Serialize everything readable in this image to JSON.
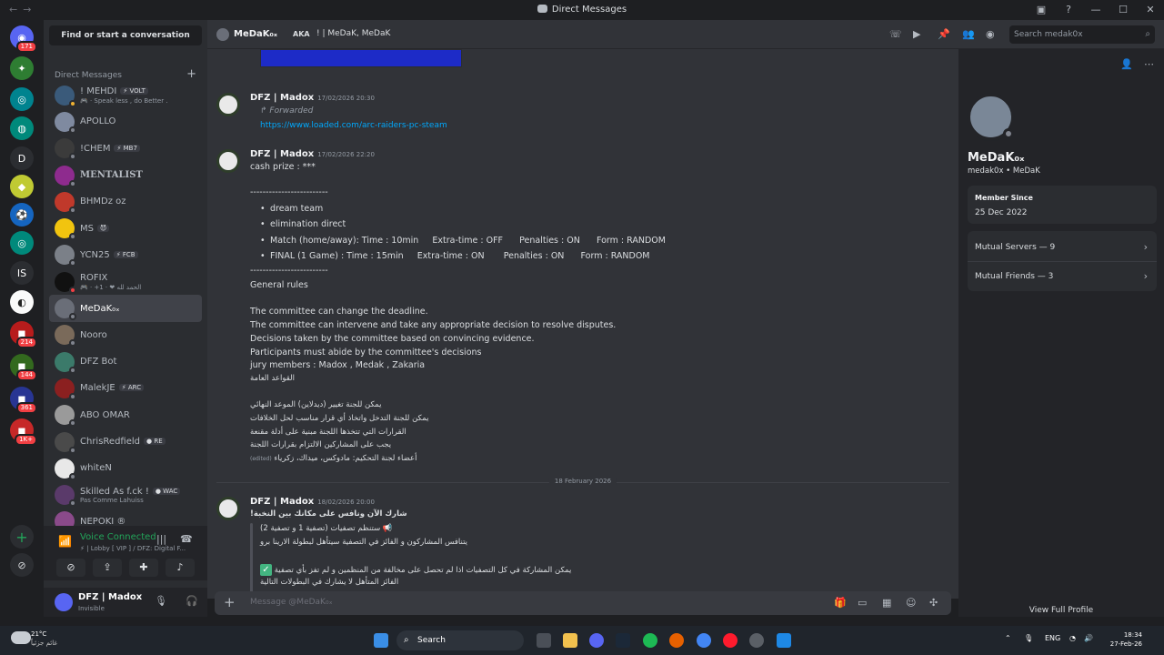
{
  "window": {
    "title": "Direct Messages",
    "controls": [
      "—",
      "☐",
      "✕"
    ]
  },
  "rail": {
    "servers": [
      {
        "name": "discord-home",
        "badge": "171",
        "color": "#5865f2",
        "glyph": "◉"
      },
      {
        "name": "server-1",
        "badge": "",
        "color": "#2e7d32",
        "glyph": "✦"
      },
      {
        "name": "server-2",
        "badge": "",
        "color": "#00838f",
        "glyph": "◎"
      },
      {
        "name": "server-3",
        "badge": "",
        "color": "#00897b",
        "glyph": "◍"
      },
      {
        "name": "server-d",
        "badge": "",
        "color": "#2b2d31",
        "glyph": "D"
      },
      {
        "name": "server-4",
        "badge": "",
        "color": "#c0ca33",
        "glyph": "◆"
      },
      {
        "name": "server-football",
        "badge": "",
        "color": "#1565c0",
        "glyph": "⚽"
      },
      {
        "name": "server-5",
        "badge": "",
        "color": "#00897b",
        "glyph": "◎"
      },
      {
        "name": "server-is",
        "badge": "",
        "color": "#2b2d31",
        "glyph": "IS"
      },
      {
        "name": "server-6",
        "badge": "",
        "color": "#fafafa",
        "glyph": "◐"
      },
      {
        "name": "server-7",
        "badge": "214",
        "color": "#b71c1c",
        "glyph": "◼"
      },
      {
        "name": "server-8",
        "badge": "144",
        "color": "#33691e",
        "glyph": "◼"
      },
      {
        "name": "server-9",
        "badge": "361",
        "color": "#283593",
        "glyph": "◼"
      },
      {
        "name": "server-10",
        "badge": "1K+",
        "color": "#c62828",
        "glyph": "◼"
      }
    ],
    "add_label": "+",
    "discover_label": "⊘"
  },
  "sidebar": {
    "find_label": "Find or start a conversation",
    "header": "Direct Messages",
    "add": "+",
    "dms": [
      {
        "name": "! MEHDI",
        "tag": "⚡ VOLT",
        "sub": "🎮 · Speak less , do Better .",
        "color": "#3a5a7a",
        "status": "#f0b232"
      },
      {
        "name": "APOLLO",
        "tag": "",
        "sub": "",
        "color": "#7f8aa0",
        "status": "#80848e"
      },
      {
        "name": "!CHEM",
        "tag": "⚡ MB7",
        "sub": "",
        "color": "#3b3b3b",
        "status": "#80848e"
      },
      {
        "name": "MENTALIST",
        "tag": "",
        "sub": "",
        "color": "#8e2b8e",
        "status": "#80848e"
      },
      {
        "name": "BHMDz oz",
        "tag": "",
        "sub": "",
        "color": "#c0392b",
        "status": "#80848e"
      },
      {
        "name": "MS",
        "tag": "😈",
        "sub": "",
        "color": "#f1c40f",
        "status": "#80848e"
      },
      {
        "name": "YCN25",
        "tag": "⚡ FCB",
        "sub": "",
        "color": "#7b8088",
        "status": "#80848e"
      },
      {
        "name": "ROFIX",
        "tag": "",
        "sub": "🎮 · +1 · ❤ الحمد لله",
        "color": "#111111",
        "status": "#f23f43"
      },
      {
        "name": "MeDaK₀ₓ",
        "tag": "",
        "sub": "",
        "color": "#6a6e78",
        "status": "#80848e"
      },
      {
        "name": "Nooro",
        "tag": "",
        "sub": "",
        "color": "#7a6a5a",
        "status": "#80848e"
      },
      {
        "name": "DFZ Bot",
        "tag": "",
        "sub": "",
        "color": "#3b7a6a",
        "status": "#80848e"
      },
      {
        "name": "MalekJE",
        "tag": "⚡ ARC",
        "sub": "",
        "color": "#8b2020",
        "status": "#80848e"
      },
      {
        "name": "ABO OMAR",
        "tag": "",
        "sub": "",
        "color": "#9a9a9a",
        "status": "#80848e"
      },
      {
        "name": "ChrisRedfield",
        "tag": "● RE",
        "sub": "",
        "color": "#4a4a4a",
        "status": "#80848e"
      },
      {
        "name": "whiteN",
        "tag": "",
        "sub": "",
        "color": "#e8e8e8",
        "status": "#80848e"
      },
      {
        "name": "Skilled As f.ck !",
        "tag": "● WAC",
        "sub": "Pas Comme Lahuiss",
        "color": "#5a3a6a",
        "status": "#80848e"
      },
      {
        "name": "NEPOKI ®",
        "tag": "",
        "sub": "",
        "color": "#8a4a8a",
        "status": "#80848e"
      }
    ],
    "voice": {
      "status": "Voice Connected",
      "channel": "⚡ | Lobby [ VIP ] / DFZ: Digital F..."
    },
    "user": {
      "name": "DFZ | Madox",
      "status": "Invisible"
    }
  },
  "chat_header": {
    "name": "MeDaK₀ₓ",
    "aka_label": "AKA",
    "aka_value": "! | MeDaK, MeDaK",
    "search_placeholder": "Search medak0x"
  },
  "messages": [
    {
      "author": "DFZ | Madox",
      "time": "17/02/2026 20:30",
      "forwarded_label": "Forwarded",
      "link": "https://www.loaded.com/arc-raiders-pc-steam"
    },
    {
      "author": "DFZ | Madox",
      "time": "17/02/2026 22:20",
      "lines": {
        "l1": "cash prize : ***",
        "l2": "-------------------------",
        "b1": "dream team",
        "b2": "elimination direct",
        "b3": "Match (home/away): Time : 10min     Extra-time : OFF      Penalties : ON      Form : RANDOM",
        "b4": "FINAL (1 Game) : Time : 15min     Extra-time : ON       Penalties : ON      Form : RANDOM",
        "l3": "-------------------------",
        "l4": "General rules",
        "l5": "The committee can change the deadline.",
        "l6": "The committee can intervene and take any appropriate decision to resolve disputes.",
        "l7": "Decisions taken by the committee based on convincing evidence.",
        "l8": "Participants must abide by the committee's decisions",
        "l9": "jury members : Madox , Medak , Zakaria",
        "ar1": "القواعد العامة",
        "ar2": "يمكن للجنة تغيير (ديدلاين) الموعد النهائي",
        "ar3": "يمكن للجنة التدخل واتخاذ أي قرار مناسب لحل الخلافات",
        "ar4": "القرارات التي تتخذها اللجنة مبنية على أدلة مقنعة",
        "ar5": "يجب على المشاركين الالتزام بقرارات اللجنة",
        "ar6": "أعضاء لجنة التحكيم: مادوكس، ميداك، زكرياء",
        "edited": "(edited)"
      }
    }
  ],
  "date_divider": "18 February 2026",
  "message3": {
    "author": "DFZ | Madox",
    "time": "18/02/2026 20:00",
    "lines": {
      "t1": "شارك الآن ونافس على مكانك بين النخبة!",
      "t2": "📢 ستنظم تصفيات (تصفية 1 و تصفية 2)",
      "t3": "يتنافس المشاركون و الفائز في التصفية سيتأهل لبطولة الارينا برو",
      "t4": "يمكن المشاركة في كل التصفيات اذا لم تحصل على مخالفة من المنظمين و لم تفز بأي تصفية",
      "t5": "الفائز المتأهل لا يشارك في البطولات التالية"
    }
  },
  "composer": {
    "plus": "+",
    "placeholder": "Message @MeDaK₀ₓ"
  },
  "profile": {
    "display_name": "MeDaK₀ₓ",
    "username": "medak0x • MeDaK",
    "member_since_label": "Member Since",
    "member_since_value": "25 Dec 2022",
    "mutual_servers": "Mutual Servers — 9",
    "mutual_friends": "Mutual Friends — 3",
    "view_full": "View Full Profile"
  },
  "taskbar": {
    "temp": "21°C",
    "weather_desc": "غائم جزئياً",
    "search_label": "Search",
    "lang": "ENG",
    "time": "18:34",
    "date": "27-Feb-26"
  }
}
